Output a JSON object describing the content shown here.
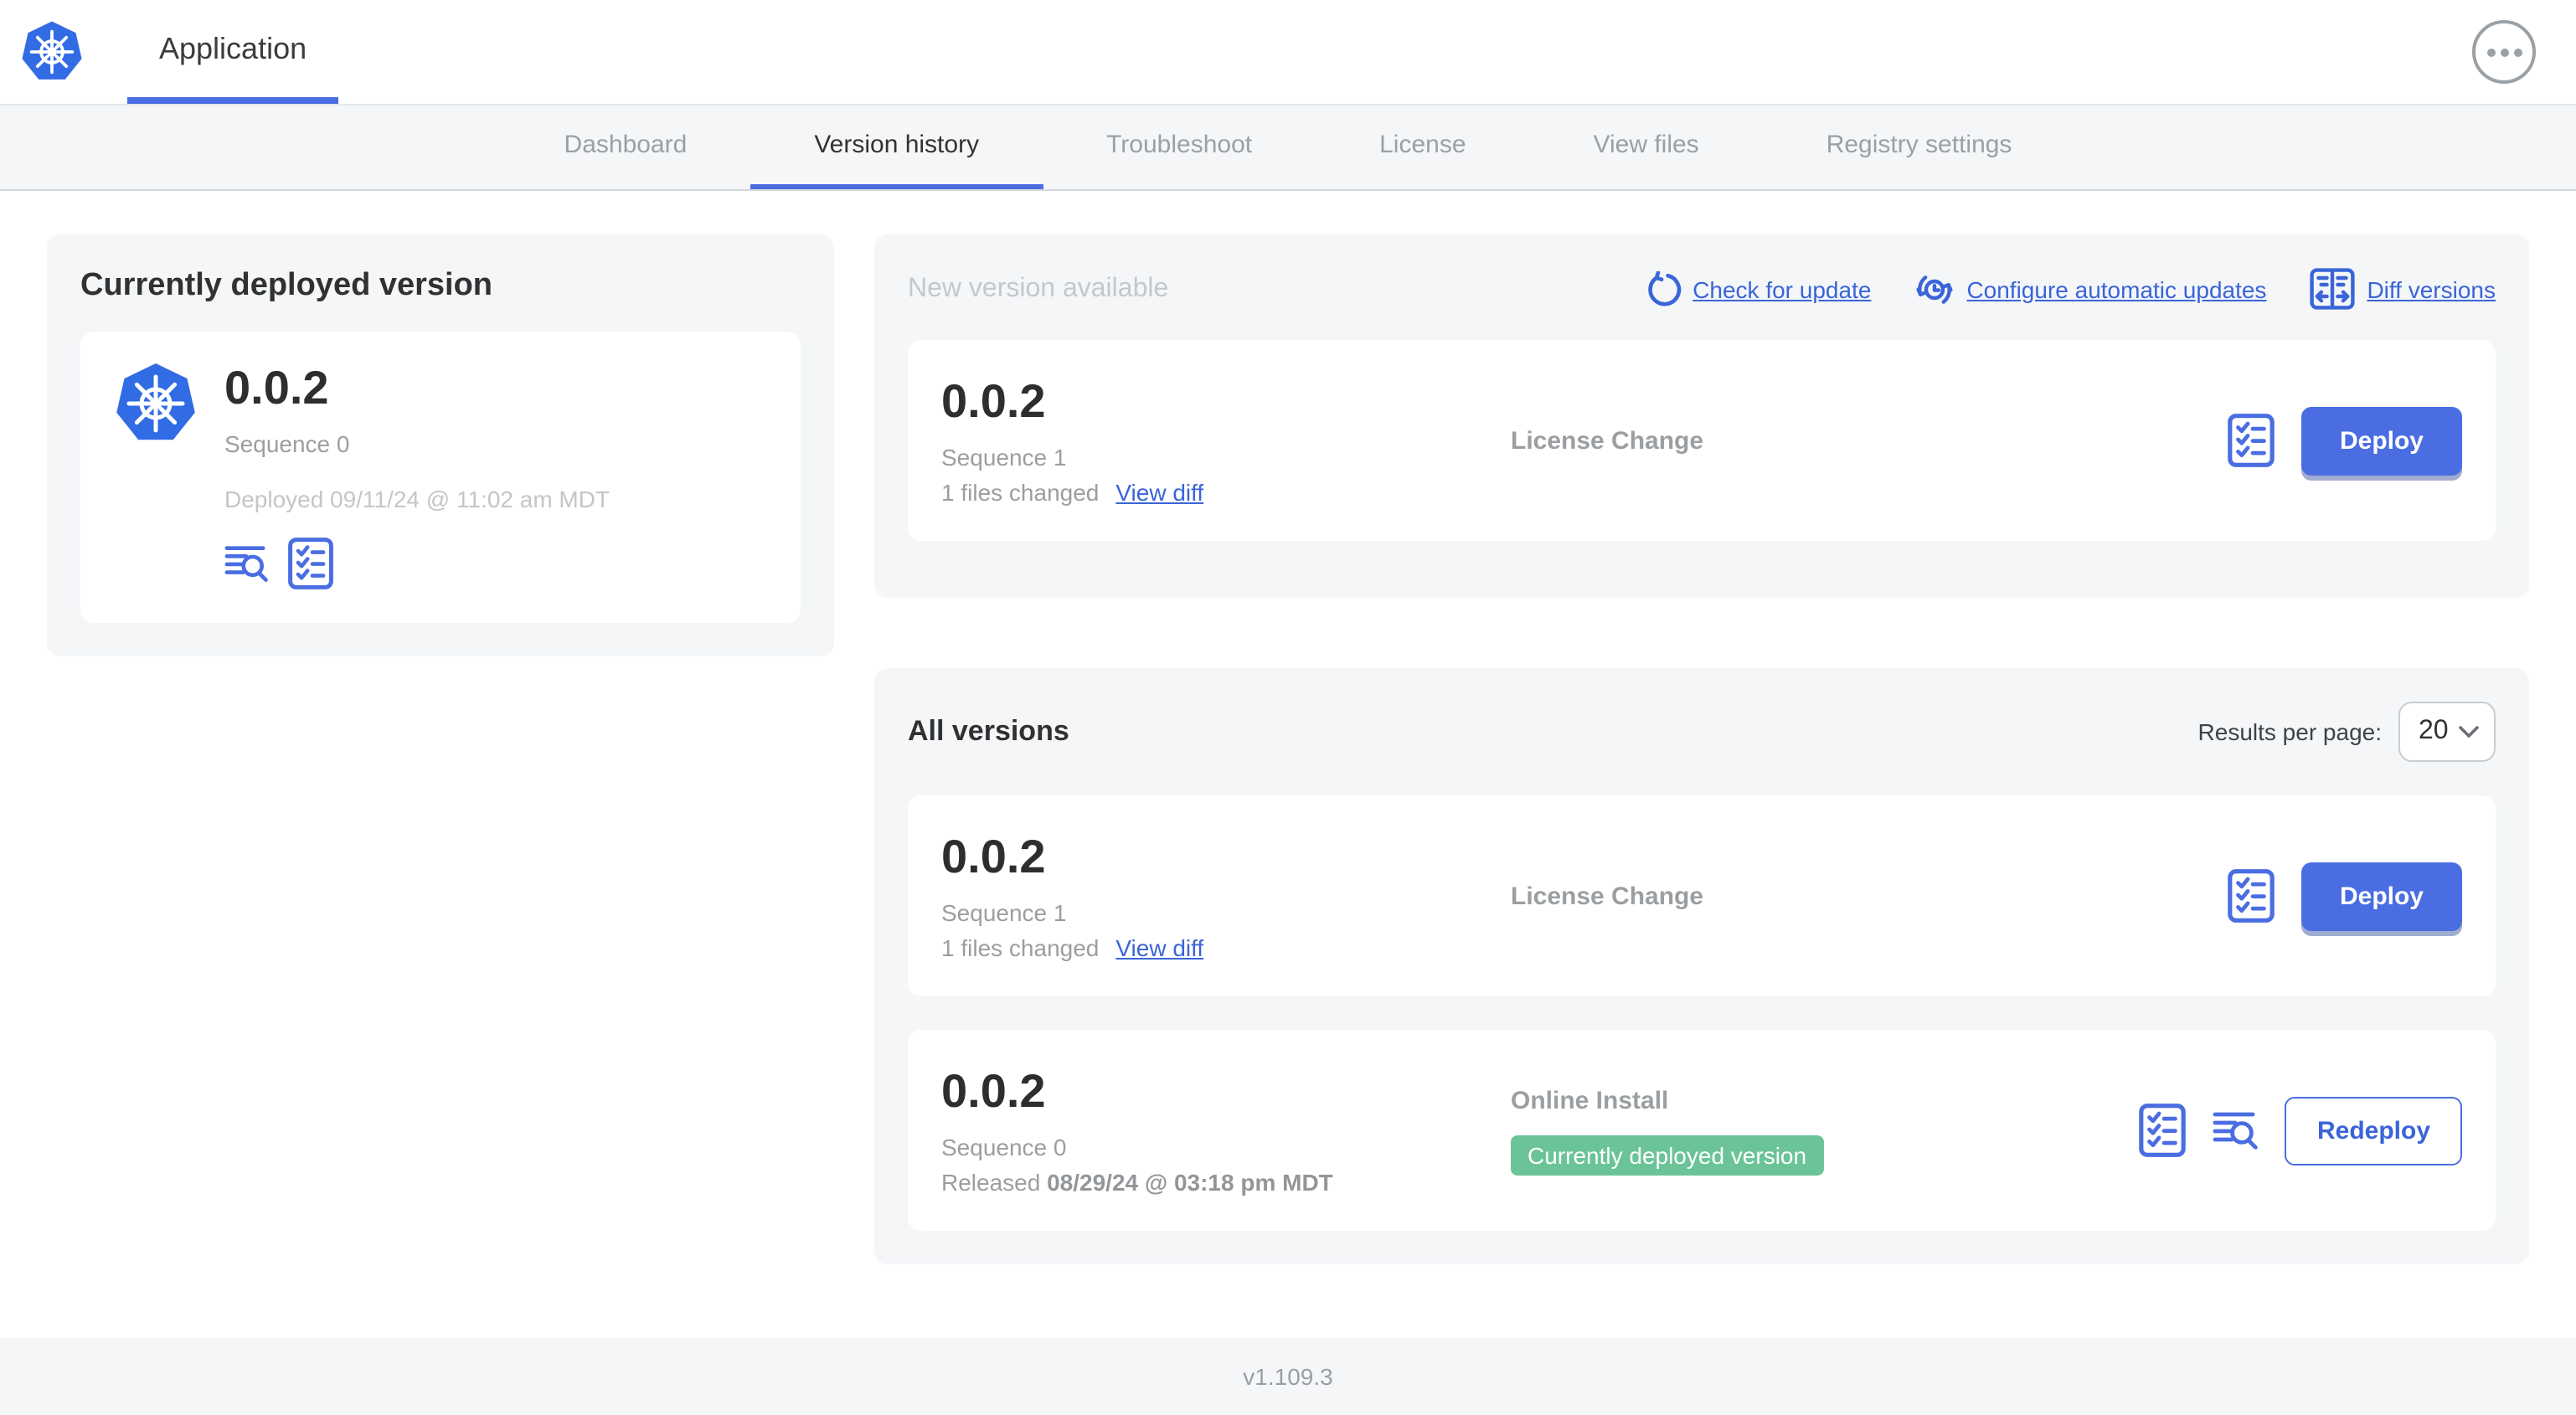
{
  "colors": {
    "primary_blue": "#4A6DE2",
    "link_blue": "#3A64D8",
    "k8s_logo_blue": "#326CE5",
    "badge_green": "#6BC497",
    "panel_gray": "#f4f6f8",
    "muted_text": "#9b9ea1",
    "faint_text": "#c5c8cb"
  },
  "header": {
    "title": "Application"
  },
  "tabs": {
    "active": "Version history",
    "items": [
      {
        "label": "Dashboard"
      },
      {
        "label": "Version history"
      },
      {
        "label": "Troubleshoot"
      },
      {
        "label": "License"
      },
      {
        "label": "View files"
      },
      {
        "label": "Registry settings"
      }
    ]
  },
  "current": {
    "panel_title": "Currently deployed version",
    "version": "0.0.2",
    "sequence": "Sequence 0",
    "deployed": "Deployed 09/11/24 @ 11:02 am MDT",
    "icons": [
      "logs-icon",
      "checklist-icon"
    ]
  },
  "newv": {
    "panel_title": "New version available",
    "actions": {
      "check": "Check for update",
      "configure": "Configure automatic updates",
      "diff": "Diff versions"
    },
    "card": {
      "version": "0.0.2",
      "sequence": "Sequence 1",
      "files_changed": "1 files changed",
      "view_diff": "View diff",
      "source": "License Change",
      "deploy_label": "Deploy",
      "icons": [
        "checklist-icon"
      ]
    }
  },
  "allv": {
    "panel_title": "All versions",
    "results_label": "Results per page:",
    "results_value": "20",
    "rows": [
      {
        "version": "0.0.2",
        "sequence": "Sequence 1",
        "files_changed": "1 files changed",
        "view_diff": "View diff",
        "source": "License Change",
        "button_label": "Deploy",
        "icons": [
          "checklist-icon"
        ]
      },
      {
        "version": "0.0.2",
        "sequence": "Sequence 0",
        "released_prefix": "Released ",
        "released_date": "08/29/24 @ 03:18 pm MDT",
        "source": "Online Install",
        "badge": "Currently deployed version",
        "button_label": "Redeploy",
        "icons": [
          "checklist-icon",
          "logs-icon"
        ]
      }
    ]
  },
  "footer": {
    "version": "v1.109.3"
  }
}
